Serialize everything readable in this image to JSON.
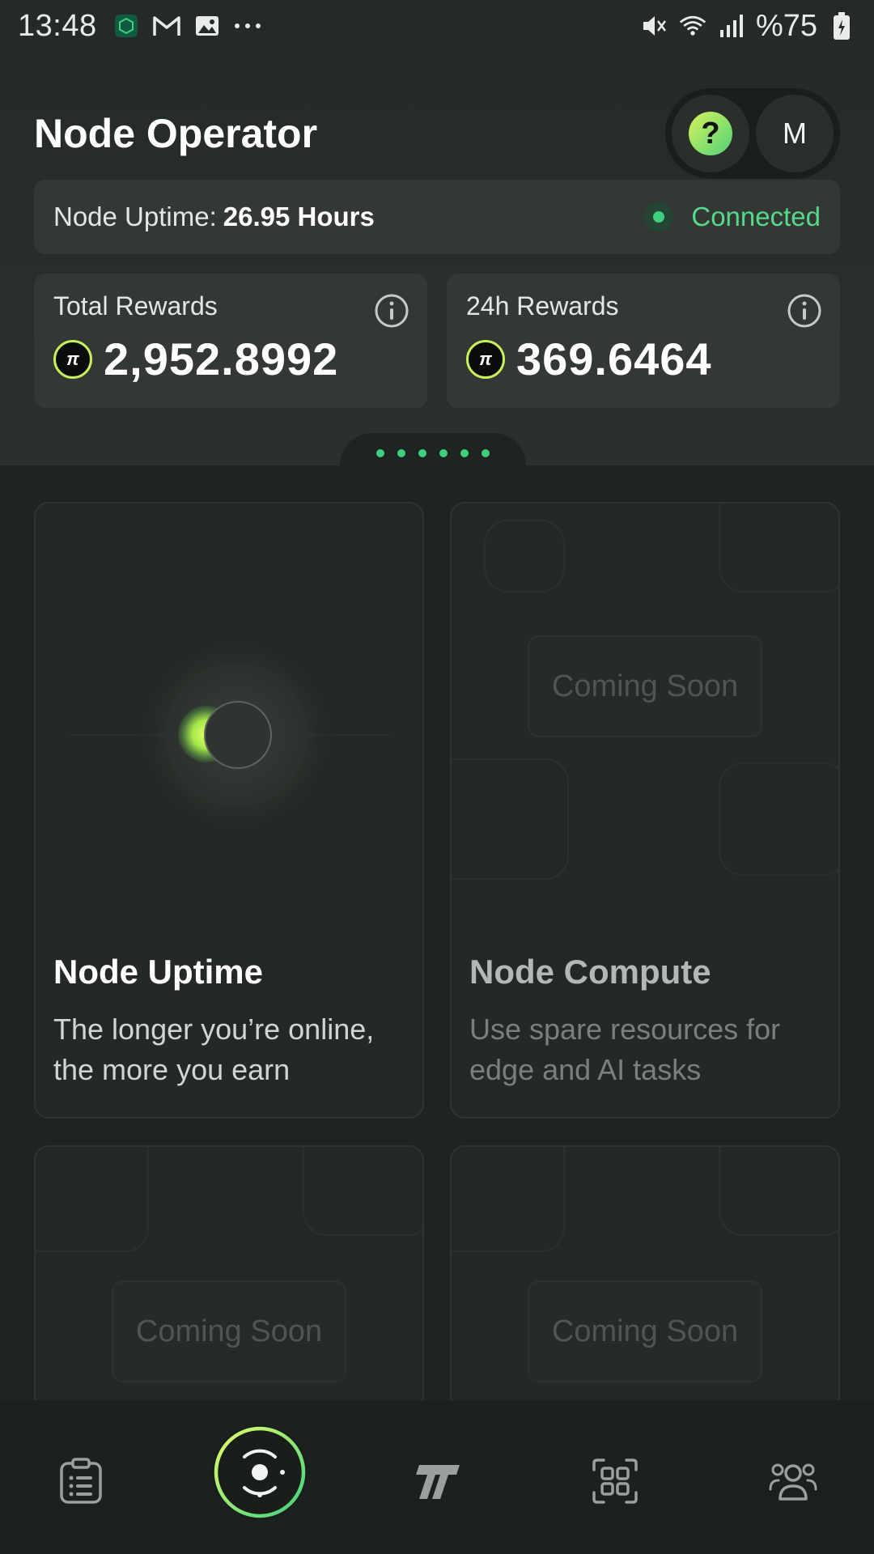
{
  "status_bar": {
    "time": "13:48",
    "left_icons": [
      "app-icon",
      "gmail-icon",
      "gallery-icon",
      "more-dots-icon"
    ],
    "right_icons": [
      "mute-icon",
      "wifi-icon",
      "signal-icon",
      "battery-icon"
    ],
    "battery": "%75"
  },
  "header": {
    "title": "Node Operator",
    "help_symbol": "?",
    "avatar_initial": "M"
  },
  "uptime": {
    "label": "Node Uptime:",
    "value": "26.95 Hours",
    "status": "Connected"
  },
  "rewards": {
    "total": {
      "label": "Total Rewards",
      "value": "2,952.8992"
    },
    "day": {
      "label": "24h Rewards",
      "value": "369.6464"
    },
    "token_symbol": "π"
  },
  "pager": {
    "dot_count": 6
  },
  "cards": {
    "uptime": {
      "title": "Node Uptime",
      "description": "The longer you’re online, the more you earn"
    },
    "compute": {
      "title": "Node Compute",
      "description": "Use spare resources for edge and AI tasks",
      "badge": "Coming Soon"
    },
    "third": {
      "badge": "Coming Soon"
    },
    "fourth": {
      "badge": "Coming Soon"
    }
  },
  "bottom_nav": {
    "items": [
      "tasks-list-icon",
      "node-orbit-icon",
      "token-logo-icon",
      "apps-grid-icon",
      "community-icon"
    ]
  },
  "colors": {
    "accent_green": "#3ed07e",
    "accent_lime": "#c9ef5b",
    "background": "#1f2421",
    "card": "#333835"
  }
}
